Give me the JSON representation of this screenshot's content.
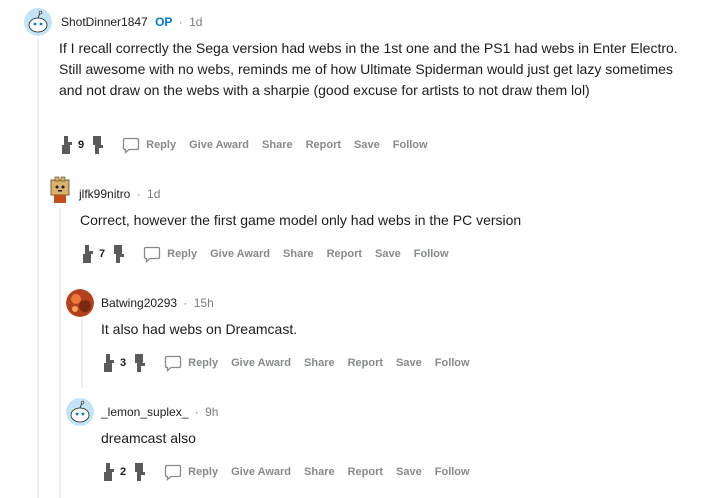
{
  "comments": [
    {
      "author": "ShotDinner1847",
      "op_badge": "OP",
      "separator": "·",
      "time": "1d",
      "body": "If I recall correctly the Sega version had webs in the 1st one and the PS1 had webs in Enter Electro. Still awesome with no webs, reminds me of how Ultimate Spiderman would just get lazy sometimes and not draw on the webs with a sharpie (good excuse for artists to not draw them lol)",
      "score": "9",
      "avatar_icon": "snoo-avatar-icon"
    },
    {
      "author": "jlfk99nitro",
      "separator": "·",
      "time": "1d",
      "body": "Correct, however the first game model only had webs in the PC version",
      "score": "7",
      "avatar_icon": "box-character-avatar-icon"
    },
    {
      "author": "Batwing20293",
      "separator": "·",
      "time": "15h",
      "body": "It also had webs on Dreamcast.",
      "score": "3",
      "avatar_icon": "orange-avatar-icon"
    },
    {
      "author": "_lemon_suplex_",
      "separator": "·",
      "time": "9h",
      "body": "dreamcast also",
      "score": "2",
      "avatar_icon": "snoo-avatar-icon"
    }
  ],
  "actions": {
    "reply": "Reply",
    "give_award": "Give Award",
    "share": "Share",
    "report": "Report",
    "save": "Save",
    "follow": "Follow"
  },
  "colors": {
    "op_badge": "#0079d3",
    "action_text": "#878a8c",
    "thread_line": "#edeff1",
    "vote_icon": "#5a5a5a"
  }
}
